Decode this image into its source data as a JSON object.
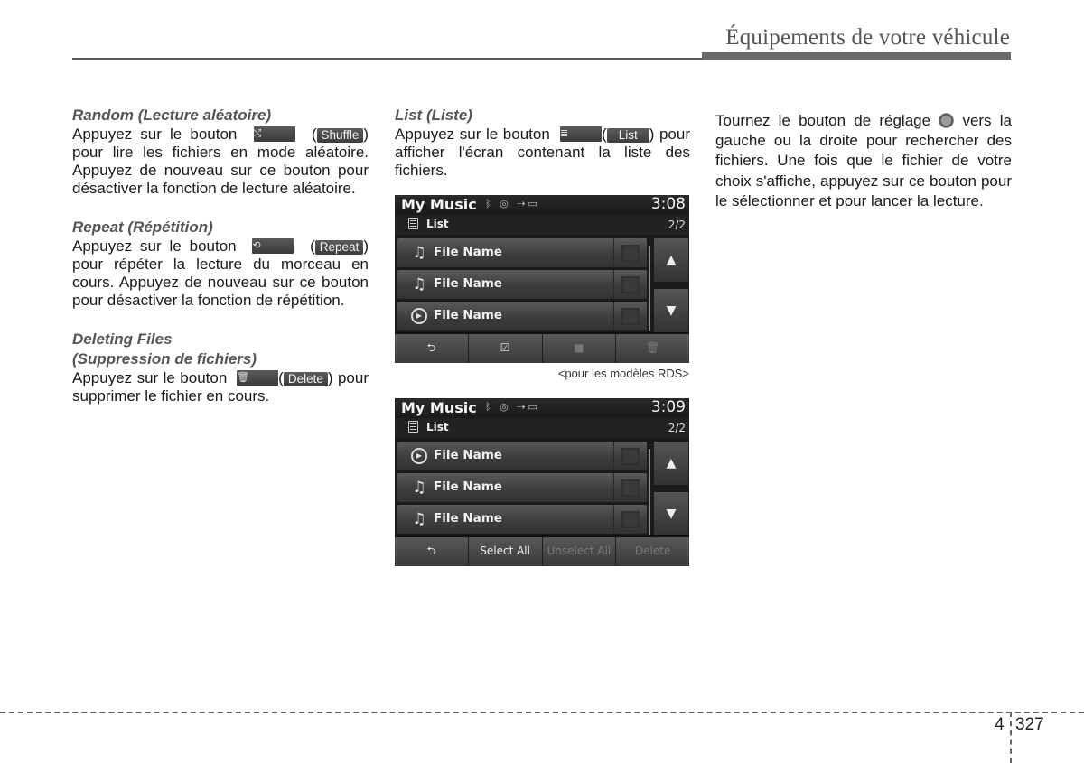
{
  "header": {
    "title": "Équipements de votre véhicule"
  },
  "col1": {
    "random": {
      "heading": "Random (Lecture aléatoire)",
      "pre": "Appuyez sur le bouton",
      "icon": "shuffle-icon",
      "label": "Shuffle",
      "post": "pour lire les fichiers en mode aléatoire. Appuyez de nouveau sur ce bouton pour désactiver la fonction de lecture aléatoire."
    },
    "repeat": {
      "heading": "Repeat (Répétition)",
      "pre": "Appuyez sur le bouton",
      "icon": "repeat-icon",
      "label": "Repeat",
      "post": "pour répéter la lecture du morceau en cours. Appuyez de nouveau sur ce bouton pour désactiver la fonction de répétition."
    },
    "delete": {
      "heading1": "Deleting Files",
      "heading2": "(Suppression de fichiers)",
      "pre": "Appuyez sur le bouton",
      "icon": "trash-icon",
      "label": "Delete",
      "post": "pour supprimer le fichier en cours."
    }
  },
  "col2": {
    "list": {
      "heading": "List (Liste)",
      "pre": "Appuyez sur le bouton",
      "icon": "list-icon",
      "label": "List",
      "post": "pour afficher l'écran contenant la liste des fichiers."
    },
    "screens": [
      {
        "title": "My Music",
        "status_icons": [
          "bluetooth-icon",
          "disc-icon",
          "usb-icon",
          "battery-icon"
        ],
        "time": "3:08",
        "sub_label": "List",
        "page": "2/2",
        "rows": [
          {
            "icon": "music-note-icon",
            "name": "File Name"
          },
          {
            "icon": "music-note-icon",
            "name": "File Name"
          },
          {
            "icon": "play-icon",
            "name": "File Name"
          }
        ],
        "bottom_buttons": [
          {
            "icon": "back-icon",
            "label": "⮌",
            "enabled": true
          },
          {
            "icon": "select-all-icon",
            "label": "☑",
            "enabled": true
          },
          {
            "icon": "unselect-all-icon",
            "label": "■",
            "enabled": false
          },
          {
            "icon": "trash-icon",
            "label": "🗑",
            "enabled": false
          }
        ]
      },
      {
        "title": "My Music",
        "status_icons": [
          "bluetooth-icon",
          "disc-icon",
          "usb-icon",
          "battery-icon"
        ],
        "time": "3:09",
        "sub_label": "List",
        "page": "2/2",
        "rows": [
          {
            "icon": "play-icon",
            "name": "File Name"
          },
          {
            "icon": "music-note-icon",
            "name": "File Name"
          },
          {
            "icon": "music-note-icon",
            "name": "File Name"
          }
        ],
        "bottom_buttons": [
          {
            "icon": "back-icon",
            "label": "⮌",
            "enabled": true
          },
          {
            "icon": "select-all-text",
            "label": "Select All",
            "enabled": true
          },
          {
            "icon": "unselect-all-text",
            "label": "Unselect All",
            "enabled": false
          },
          {
            "icon": "delete-text",
            "label": "Delete",
            "enabled": false
          }
        ]
      }
    ],
    "caption": "<pour les modèles RDS>"
  },
  "col3": {
    "pre": "Tournez le bouton de réglage",
    "icon": "tune-knob-icon",
    "post": "vers la gauche ou la droite pour rechercher des fichiers. Une fois que le fichier de votre choix s'affiche, appuyez sur ce bouton pour le sélectionner et pour lancer la lecture."
  },
  "footer": {
    "chapter": "4",
    "page": "327"
  },
  "glyphs": {
    "shuffle": "⤭",
    "repeat": "⟲",
    "trash": "🗑",
    "list": "≣",
    "note": "♫",
    "play": "▶",
    "up": "▲",
    "down": "▼",
    "bt": "ᛒ",
    "disc": "◉",
    "usb": "⭠",
    "status": "ᛒ ◎ ⇢▭"
  }
}
